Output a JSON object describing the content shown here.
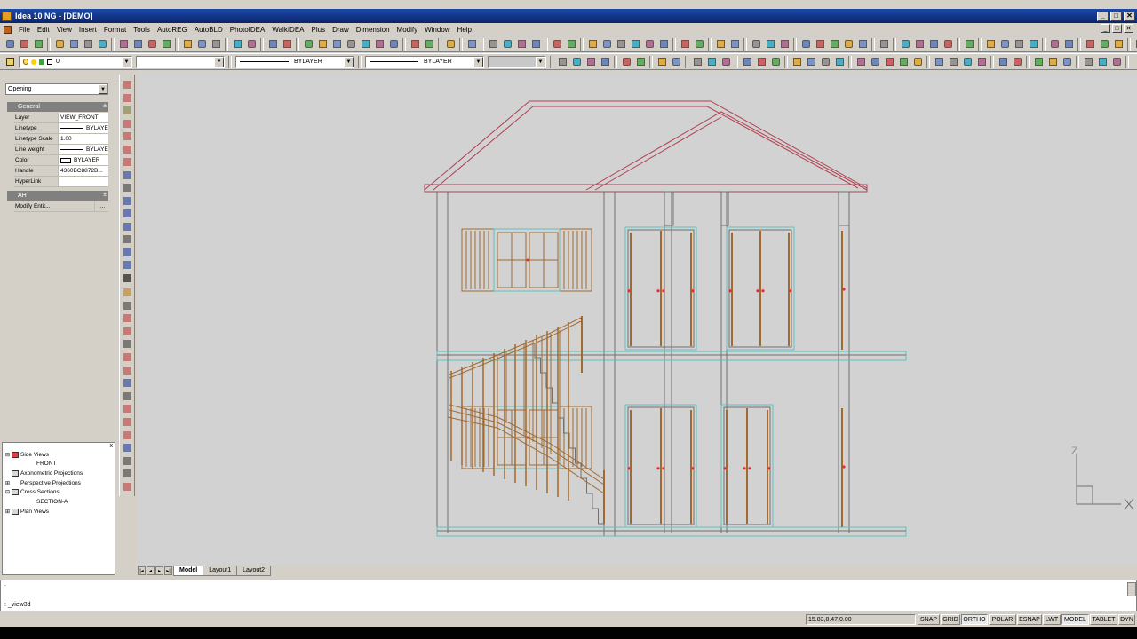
{
  "window": {
    "title": "Idea 10 NG - [DEMO]",
    "min_label": "_",
    "max_label": "□",
    "close_label": "✕"
  },
  "menu": {
    "items": [
      "File",
      "Edit",
      "View",
      "Insert",
      "Format",
      "Tools",
      "AutoREG",
      "AutoBLD",
      "PhotoIDEA",
      "WalkIDEA",
      "Plus",
      "Draw",
      "Dimension",
      "Modify",
      "Window",
      "Help"
    ]
  },
  "toolbar2": {
    "layer_combo": "0",
    "color_combo": "",
    "linetype_combo": "BYLAYER",
    "lineweight_combo": "BYLAYER",
    "plotstyle_combo": ""
  },
  "properties": {
    "selector": "Opening",
    "general_header": "General",
    "rows": [
      {
        "key": "Layer",
        "value": "VIEW_FRONT"
      },
      {
        "key": "Linetype",
        "value": "BYLAYE"
      },
      {
        "key": "Linetype Scale",
        "value": "1.00"
      },
      {
        "key": "Line weight",
        "value": "BYLAYE"
      },
      {
        "key": "Color",
        "value": "BYLAYER"
      },
      {
        "key": "Handle",
        "value": "4360BC8872B..."
      },
      {
        "key": "HyperLink",
        "value": ""
      }
    ],
    "ah_header": "AH",
    "modify_row": {
      "key": "Modify Entit...",
      "value": "..."
    },
    "collapse_symbol": "±"
  },
  "project_tree": {
    "close_label": "x",
    "items": [
      {
        "label": "Side Views",
        "level": 0,
        "expander": "⊟"
      },
      {
        "label": "FRONT",
        "level": 2,
        "expander": ""
      },
      {
        "label": "Axonometric Projections",
        "level": 0,
        "expander": ""
      },
      {
        "label": "Perspective Projections",
        "level": 0,
        "expander": "⊞"
      },
      {
        "label": "Cross Sections",
        "level": 0,
        "expander": "⊟"
      },
      {
        "label": "SECTION-A",
        "level": 2,
        "expander": ""
      },
      {
        "label": "Plan Views",
        "level": 0,
        "expander": "⊞"
      }
    ]
  },
  "tabs": {
    "nav": [
      "|◂",
      "◂",
      "▸",
      "▸|"
    ],
    "items": [
      "Model",
      "Layout1",
      "Layout2"
    ],
    "active": "Model"
  },
  "drawing": {
    "ucs_z_label": "Z"
  },
  "command": {
    "prompt": ":",
    "last": ": _view3d"
  },
  "status": {
    "coords": "15.83,8.47,0.00",
    "buttons": [
      "SNAP",
      "GRID",
      "ORTHO",
      "POLAR",
      "ESNAP",
      "LWT",
      "MODEL",
      "TABLET",
      "DYN"
    ],
    "active": [
      "ORTHO",
      "MODEL"
    ]
  },
  "colors": {
    "roof_red": "#b04050",
    "wall_gray": "#707070",
    "glass_cyan": "#60c0c0",
    "wood_brown": "#a06a30",
    "canvas_bg": "#d2d2d2",
    "title_blue": "#0a246a"
  }
}
